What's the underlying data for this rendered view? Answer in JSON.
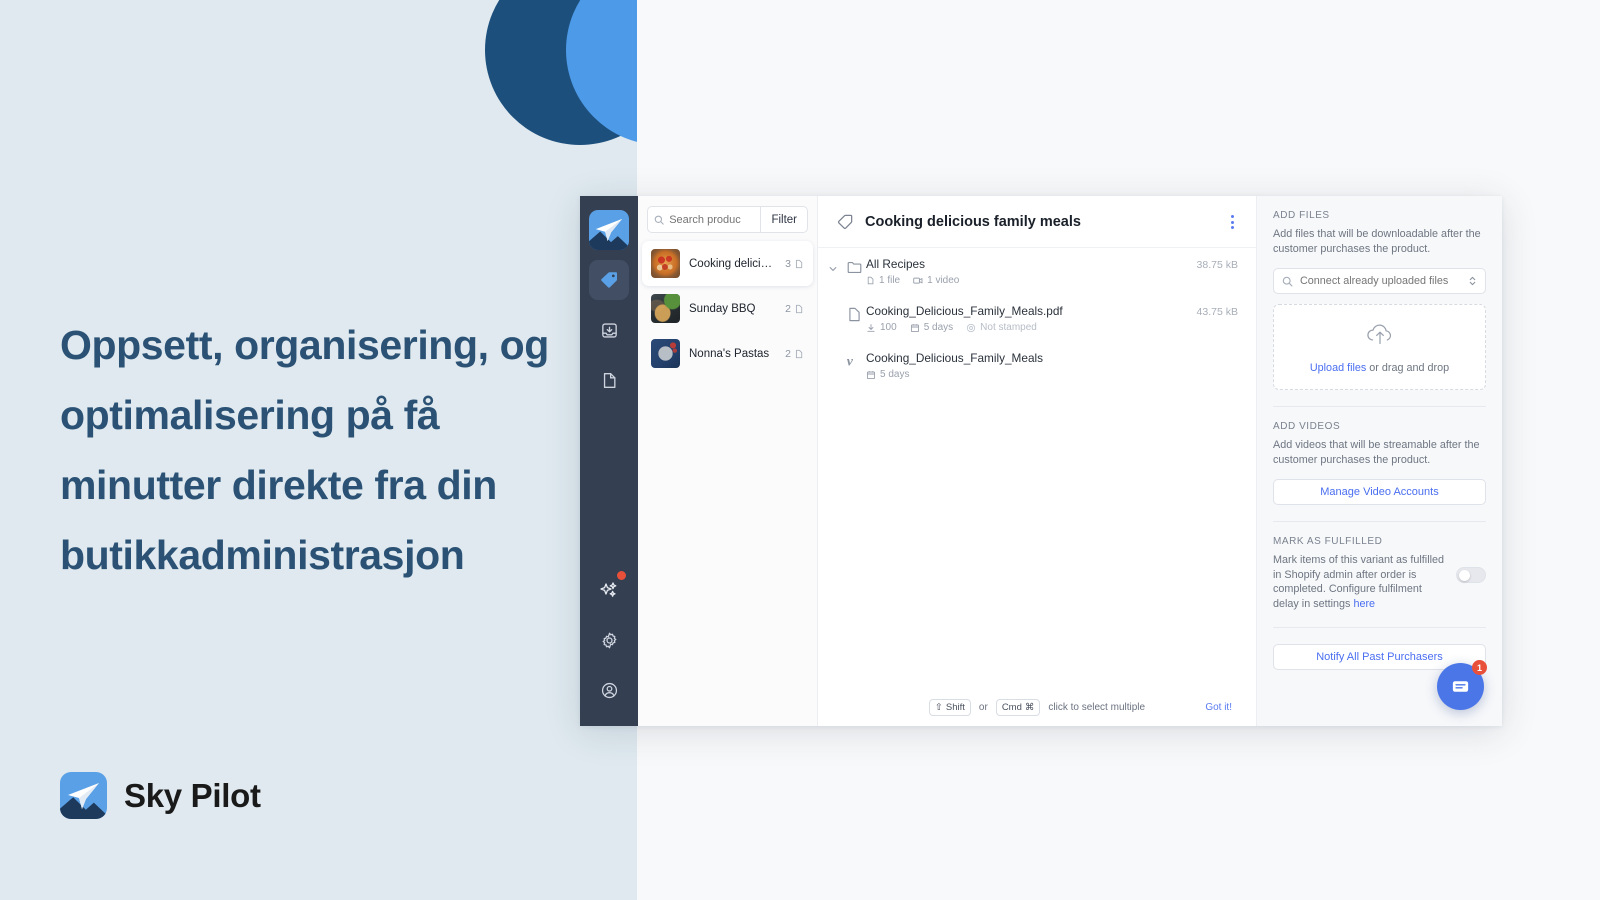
{
  "marketing": {
    "headline": "Oppsett, organisering, og optimalisering på få minutter direkte fra din butikkadministrasjon",
    "brand_name": "Sky Pilot",
    "colors": {
      "background": "#dfe9ef",
      "headline_color": "#2b5275",
      "circle_dark": "#1d4f7c",
      "circle_light": "#4d9ae8"
    }
  },
  "app": {
    "rail": {
      "items": [
        {
          "name": "brand-logo",
          "label": "Sky Pilot"
        },
        {
          "name": "tag",
          "label": "Products"
        },
        {
          "name": "inbox-download",
          "label": "Downloads"
        },
        {
          "name": "page",
          "label": "Pages"
        },
        {
          "name": "sparkles",
          "label": "What's new",
          "badge": true
        },
        {
          "name": "gear",
          "label": "Settings"
        },
        {
          "name": "account",
          "label": "Account"
        }
      ]
    },
    "product_list": {
      "search_placeholder": "Search produc",
      "search_value": "",
      "filter_label": "Filter",
      "items": [
        {
          "name": "Cooking delicious f...",
          "count": "3",
          "selected": true,
          "thumb": "pizza"
        },
        {
          "name": "Sunday BBQ",
          "count": "2",
          "selected": false,
          "thumb": "bbq"
        },
        {
          "name": "Nonna's Pastas",
          "count": "2",
          "selected": false,
          "thumb": "pasta"
        }
      ]
    },
    "detail": {
      "title": "Cooking delicious family meals",
      "rows": [
        {
          "type": "folder",
          "name": "All Recipes",
          "meta": [
            {
              "icon": "file-icon",
              "text": "1 file"
            },
            {
              "icon": "video-icon",
              "text": "1 video"
            }
          ],
          "size": "38.75 kB"
        },
        {
          "type": "pdf",
          "name": "Cooking_Delicious_Family_Meals.pdf",
          "meta": [
            {
              "icon": "download-icon",
              "text": "100"
            },
            {
              "icon": "calendar-icon",
              "text": "5 days"
            },
            {
              "icon": "stamp-icon",
              "text": "Not stamped",
              "dim": true
            }
          ],
          "size": "43.75 kB"
        },
        {
          "type": "vimeo",
          "name": "Cooking_Delicious_Family_Meals",
          "meta": [
            {
              "icon": "calendar-icon",
              "text": "5 days"
            }
          ],
          "size": ""
        }
      ],
      "hint": {
        "key1": "Shift",
        "key1_symbol": "⇧",
        "or": "or",
        "key2": "Cmd",
        "key2_symbol": "⌘",
        "text": "click to select multiple",
        "dismiss": "Got it!"
      }
    },
    "settings": {
      "add_files": {
        "title": "ADD FILES",
        "description": "Add files that will be downloadable after the customer purchases the product.",
        "connect_placeholder": "Connect already uploaded files",
        "upload_link": "Upload files",
        "upload_rest": " or drag and drop"
      },
      "add_videos": {
        "title": "ADD VIDEOS",
        "description": "Add videos that will be streamable after the customer purchases the product.",
        "button_label": "Manage Video Accounts"
      },
      "mark_fulfilled": {
        "title": "MARK AS FULFILLED",
        "description": "Mark items of this variant as fulfilled in Shopify admin after order is completed. Configure fulfilment delay in settings ",
        "link": "here",
        "toggle_on": false
      },
      "notify_button": "Notify All Past Purchasers"
    },
    "chat": {
      "badge_count": "1"
    }
  }
}
